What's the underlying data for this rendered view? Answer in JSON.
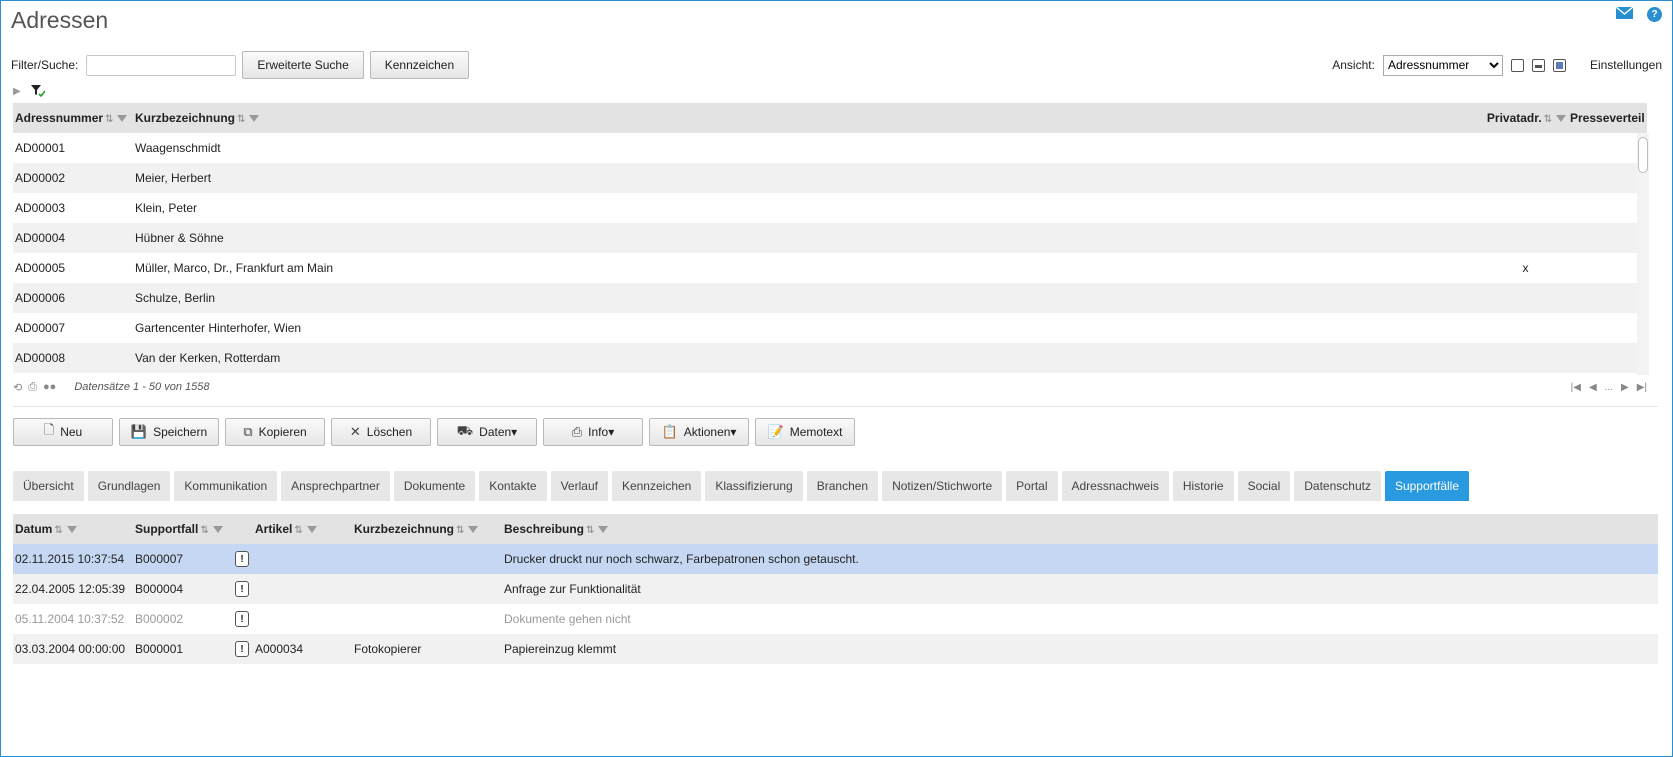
{
  "header": {
    "title": "Adressen",
    "help_glyph": "?"
  },
  "filter": {
    "label": "Filter/Suche:",
    "value": "",
    "advanced_search": "Erweiterte Suche",
    "tags": "Kennzeichen",
    "view_label": "Ansicht:",
    "view_selected": "Adressnummer",
    "settings": "Einstellungen"
  },
  "address_table": {
    "columns": [
      "Adressnummer",
      "Kurzbezeichnung",
      "Privatadr.",
      "Presseverteil"
    ],
    "rows": [
      {
        "nr": "AD00001",
        "name": "Waagenschmidt",
        "priv": "",
        "press": ""
      },
      {
        "nr": "AD00002",
        "name": "Meier, Herbert",
        "priv": "",
        "press": ""
      },
      {
        "nr": "AD00003",
        "name": "Klein, Peter",
        "priv": "",
        "press": ""
      },
      {
        "nr": "AD00004",
        "name": "Hübner & Söhne",
        "priv": "",
        "press": ""
      },
      {
        "nr": "AD00005",
        "name": "Müller, Marco, Dr., Frankfurt am Main",
        "priv": "x",
        "press": ""
      },
      {
        "nr": "AD00006",
        "name": "Schulze, Berlin",
        "priv": "",
        "press": ""
      },
      {
        "nr": "AD00007",
        "name": "Gartencenter Hinterhofer, Wien",
        "priv": "",
        "press": ""
      },
      {
        "nr": "AD00008",
        "name": "Van der Kerken, Rotterdam",
        "priv": "",
        "press": ""
      }
    ],
    "pager_text": "Datensätze 1 - 50 von 1558",
    "pager_ellipsis": "..."
  },
  "actions": [
    "Neu",
    "Speichern",
    "Kopieren",
    "Löschen",
    "Daten▾",
    "Info▾",
    "Aktionen▾",
    "Memotext"
  ],
  "tabs": [
    "Übersicht",
    "Grundlagen",
    "Kommunikation",
    "Ansprechpartner",
    "Dokumente",
    "Kontakte",
    "Verlauf",
    "Kennzeichen",
    "Klassifizierung",
    "Branchen",
    "Notizen/Stichworte",
    "Portal",
    "Adressnachweis",
    "Historie",
    "Social",
    "Datenschutz",
    "Supportfälle"
  ],
  "active_tab": "Supportfälle",
  "support_table": {
    "columns": [
      "Datum",
      "Supportfall",
      "Artikel",
      "Kurzbezeichnung",
      "Beschreibung"
    ],
    "rows": [
      {
        "datum": "02.11.2015 10:37:54",
        "fall": "B000007",
        "artikel": "",
        "kurz": "",
        "beschreibung": "Drucker druckt nur noch schwarz, Farbepatronen schon getauscht.",
        "state": "selected"
      },
      {
        "datum": "22.04.2005 12:05:39",
        "fall": "B000004",
        "artikel": "",
        "kurz": "",
        "beschreibung": "Anfrage zur Funktionalität",
        "state": "normal"
      },
      {
        "datum": "05.11.2004 10:37:52",
        "fall": "B000002",
        "artikel": "",
        "kurz": "",
        "beschreibung": "Dokumente gehen nicht",
        "state": "dimmed"
      },
      {
        "datum": "03.03.2004 00:00:00",
        "fall": "B000001",
        "artikel": "A000034",
        "kurz": "Fotokopierer",
        "beschreibung": "Papiereinzug klemmt",
        "state": "normal"
      }
    ],
    "priority_glyph": "!"
  },
  "colors": {
    "accent": "#2a9ae0",
    "selected_row": "#c6d7f3",
    "frame": "#2a8fd1"
  }
}
